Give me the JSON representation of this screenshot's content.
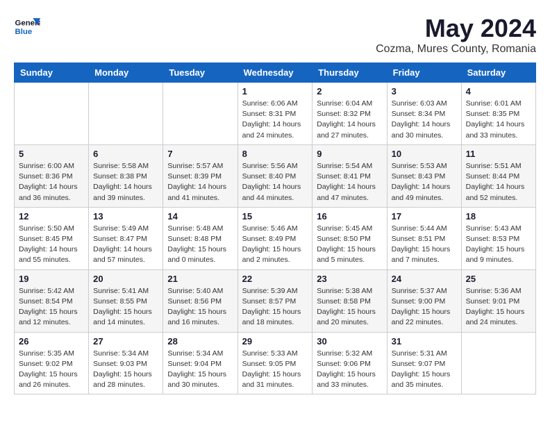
{
  "header": {
    "logo_general": "General",
    "logo_blue": "Blue",
    "month": "May 2024",
    "location": "Cozma, Mures County, Romania"
  },
  "weekdays": [
    "Sunday",
    "Monday",
    "Tuesday",
    "Wednesday",
    "Thursday",
    "Friday",
    "Saturday"
  ],
  "weeks": [
    [
      {
        "day": "",
        "info": ""
      },
      {
        "day": "",
        "info": ""
      },
      {
        "day": "",
        "info": ""
      },
      {
        "day": "1",
        "info": "Sunrise: 6:06 AM\nSunset: 8:31 PM\nDaylight: 14 hours\nand 24 minutes."
      },
      {
        "day": "2",
        "info": "Sunrise: 6:04 AM\nSunset: 8:32 PM\nDaylight: 14 hours\nand 27 minutes."
      },
      {
        "day": "3",
        "info": "Sunrise: 6:03 AM\nSunset: 8:34 PM\nDaylight: 14 hours\nand 30 minutes."
      },
      {
        "day": "4",
        "info": "Sunrise: 6:01 AM\nSunset: 8:35 PM\nDaylight: 14 hours\nand 33 minutes."
      }
    ],
    [
      {
        "day": "5",
        "info": "Sunrise: 6:00 AM\nSunset: 8:36 PM\nDaylight: 14 hours\nand 36 minutes."
      },
      {
        "day": "6",
        "info": "Sunrise: 5:58 AM\nSunset: 8:38 PM\nDaylight: 14 hours\nand 39 minutes."
      },
      {
        "day": "7",
        "info": "Sunrise: 5:57 AM\nSunset: 8:39 PM\nDaylight: 14 hours\nand 41 minutes."
      },
      {
        "day": "8",
        "info": "Sunrise: 5:56 AM\nSunset: 8:40 PM\nDaylight: 14 hours\nand 44 minutes."
      },
      {
        "day": "9",
        "info": "Sunrise: 5:54 AM\nSunset: 8:41 PM\nDaylight: 14 hours\nand 47 minutes."
      },
      {
        "day": "10",
        "info": "Sunrise: 5:53 AM\nSunset: 8:43 PM\nDaylight: 14 hours\nand 49 minutes."
      },
      {
        "day": "11",
        "info": "Sunrise: 5:51 AM\nSunset: 8:44 PM\nDaylight: 14 hours\nand 52 minutes."
      }
    ],
    [
      {
        "day": "12",
        "info": "Sunrise: 5:50 AM\nSunset: 8:45 PM\nDaylight: 14 hours\nand 55 minutes."
      },
      {
        "day": "13",
        "info": "Sunrise: 5:49 AM\nSunset: 8:47 PM\nDaylight: 14 hours\nand 57 minutes."
      },
      {
        "day": "14",
        "info": "Sunrise: 5:48 AM\nSunset: 8:48 PM\nDaylight: 15 hours\nand 0 minutes."
      },
      {
        "day": "15",
        "info": "Sunrise: 5:46 AM\nSunset: 8:49 PM\nDaylight: 15 hours\nand 2 minutes."
      },
      {
        "day": "16",
        "info": "Sunrise: 5:45 AM\nSunset: 8:50 PM\nDaylight: 15 hours\nand 5 minutes."
      },
      {
        "day": "17",
        "info": "Sunrise: 5:44 AM\nSunset: 8:51 PM\nDaylight: 15 hours\nand 7 minutes."
      },
      {
        "day": "18",
        "info": "Sunrise: 5:43 AM\nSunset: 8:53 PM\nDaylight: 15 hours\nand 9 minutes."
      }
    ],
    [
      {
        "day": "19",
        "info": "Sunrise: 5:42 AM\nSunset: 8:54 PM\nDaylight: 15 hours\nand 12 minutes."
      },
      {
        "day": "20",
        "info": "Sunrise: 5:41 AM\nSunset: 8:55 PM\nDaylight: 15 hours\nand 14 minutes."
      },
      {
        "day": "21",
        "info": "Sunrise: 5:40 AM\nSunset: 8:56 PM\nDaylight: 15 hours\nand 16 minutes."
      },
      {
        "day": "22",
        "info": "Sunrise: 5:39 AM\nSunset: 8:57 PM\nDaylight: 15 hours\nand 18 minutes."
      },
      {
        "day": "23",
        "info": "Sunrise: 5:38 AM\nSunset: 8:58 PM\nDaylight: 15 hours\nand 20 minutes."
      },
      {
        "day": "24",
        "info": "Sunrise: 5:37 AM\nSunset: 9:00 PM\nDaylight: 15 hours\nand 22 minutes."
      },
      {
        "day": "25",
        "info": "Sunrise: 5:36 AM\nSunset: 9:01 PM\nDaylight: 15 hours\nand 24 minutes."
      }
    ],
    [
      {
        "day": "26",
        "info": "Sunrise: 5:35 AM\nSunset: 9:02 PM\nDaylight: 15 hours\nand 26 minutes."
      },
      {
        "day": "27",
        "info": "Sunrise: 5:34 AM\nSunset: 9:03 PM\nDaylight: 15 hours\nand 28 minutes."
      },
      {
        "day": "28",
        "info": "Sunrise: 5:34 AM\nSunset: 9:04 PM\nDaylight: 15 hours\nand 30 minutes."
      },
      {
        "day": "29",
        "info": "Sunrise: 5:33 AM\nSunset: 9:05 PM\nDaylight: 15 hours\nand 31 minutes."
      },
      {
        "day": "30",
        "info": "Sunrise: 5:32 AM\nSunset: 9:06 PM\nDaylight: 15 hours\nand 33 minutes."
      },
      {
        "day": "31",
        "info": "Sunrise: 5:31 AM\nSunset: 9:07 PM\nDaylight: 15 hours\nand 35 minutes."
      },
      {
        "day": "",
        "info": ""
      }
    ]
  ]
}
